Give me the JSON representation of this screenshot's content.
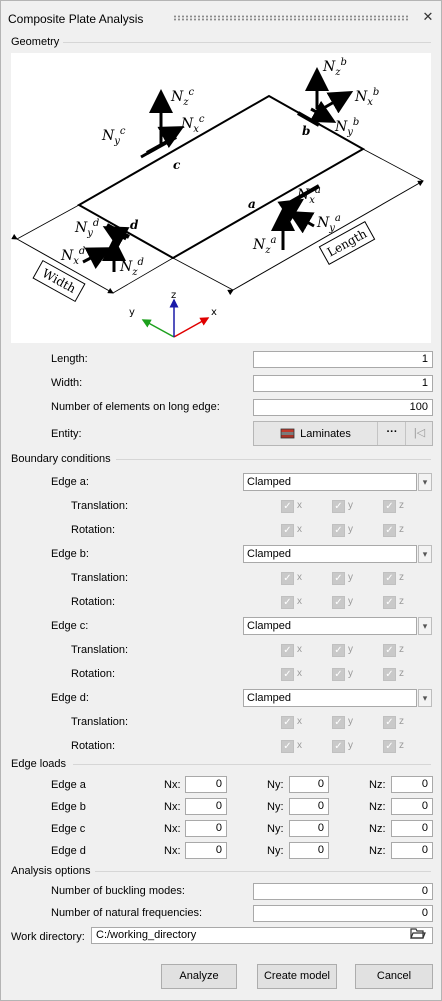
{
  "window": {
    "title": "Composite Plate Analysis",
    "close": "✕"
  },
  "geometry": {
    "section": "Geometry",
    "diagram": {
      "edges": {
        "a": "a",
        "b": "b",
        "c": "c",
        "d": "d"
      },
      "dims": {
        "length": "Length",
        "width": "Width"
      },
      "axes": {
        "x": "x",
        "y": "y",
        "z": "z"
      },
      "loads": {
        "c": {
          "z": "N",
          "zsub": "z",
          "zsup": "c",
          "x": "N",
          "xsub": "x",
          "xsup": "c",
          "y": "N",
          "ysub": "y",
          "ysup": "c"
        },
        "b": {
          "z": "N",
          "zsub": "z",
          "zsup": "b",
          "x": "N",
          "xsub": "x",
          "xsup": "b",
          "y": "N",
          "ysub": "y",
          "ysup": "b"
        },
        "a": {
          "z": "N",
          "zsub": "z",
          "zsup": "a",
          "x": "N",
          "xsub": "x",
          "xsup": "a",
          "y": "N",
          "ysub": "y",
          "ysup": "a"
        },
        "d": {
          "z": "N",
          "zsub": "z",
          "zsup": "d",
          "x": "N",
          "xsub": "x",
          "xsup": "d",
          "y": "N",
          "ysub": "y",
          "ysup": "d"
        }
      }
    },
    "length_label": "Length:",
    "length_value": "1",
    "width_label": "Width:",
    "width_value": "1",
    "elements_label": "Number of elements on long edge:",
    "elements_value": "100",
    "entity_label": "Entity:",
    "entity_value": "Laminates",
    "entity_more": "···",
    "entity_clear": "|◁"
  },
  "boundary": {
    "section": "Boundary conditions",
    "translation_label": "Translation:",
    "rotation_label": "Rotation:",
    "axis_labels": [
      "x",
      "y",
      "z"
    ],
    "check": "✓",
    "arrow": "▾",
    "edges": [
      {
        "label": "Edge a:",
        "value": "Clamped"
      },
      {
        "label": "Edge b:",
        "value": "Clamped"
      },
      {
        "label": "Edge c:",
        "value": "Clamped"
      },
      {
        "label": "Edge d:",
        "value": "Clamped"
      }
    ]
  },
  "edge_loads": {
    "section": "Edge loads",
    "nx_label": "Nx:",
    "ny_label": "Ny:",
    "nz_label": "Nz:",
    "rows": [
      {
        "label": "Edge a",
        "nx": "0",
        "ny": "0",
        "nz": "0"
      },
      {
        "label": "Edge b",
        "nx": "0",
        "ny": "0",
        "nz": "0"
      },
      {
        "label": "Edge c",
        "nx": "0",
        "ny": "0",
        "nz": "0"
      },
      {
        "label": "Edge d",
        "nx": "0",
        "ny": "0",
        "nz": "0"
      }
    ]
  },
  "analysis": {
    "section": "Analysis options",
    "buckling_label": "Number of buckling modes:",
    "buckling_value": "0",
    "frequencies_label": "Number of natural frequencies:",
    "frequencies_value": "0",
    "workdir_label": "Work directory:",
    "workdir_value": "C:/working_directory"
  },
  "buttons": {
    "analyze": "Analyze",
    "create": "Create model",
    "cancel": "Cancel"
  }
}
